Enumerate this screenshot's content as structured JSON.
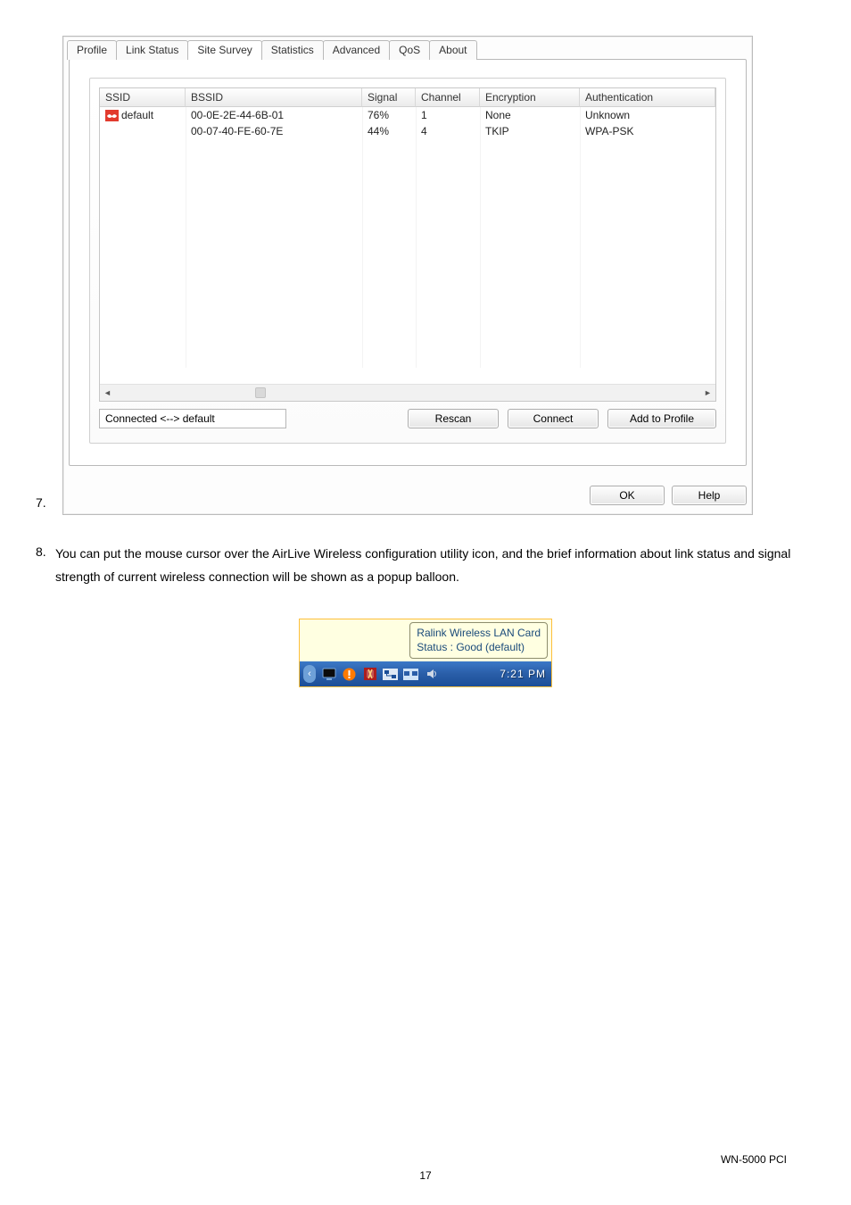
{
  "list_numbers": {
    "seven": "7.",
    "eight": "8."
  },
  "dialog": {
    "tabs": {
      "profile": "Profile",
      "link_status": "Link Status",
      "site_survey": "Site Survey",
      "statistics": "Statistics",
      "advanced": "Advanced",
      "qos": "QoS",
      "about": "About"
    },
    "columns": {
      "ssid": "SSID",
      "bssid": "BSSID",
      "signal": "Signal",
      "channel": "Channel",
      "encryption": "Encryption",
      "authentication": "Authentication"
    },
    "rows": [
      {
        "ssid": "default",
        "bssid": "00-0E-2E-44-6B-01",
        "signal": "76%",
        "channel": "1",
        "encryption": "None",
        "authentication": "Unknown",
        "connected": true
      },
      {
        "ssid": " ",
        "bssid": "00-07-40-FE-60-7E",
        "signal": "44%",
        "channel": "4",
        "encryption": "TKIP",
        "authentication": "WPA-PSK",
        "connected": false
      }
    ],
    "scrollbar": {
      "left": "◄",
      "right": "►",
      "thumb_hint": "III"
    },
    "status_field": "Connected <--> default",
    "buttons": {
      "rescan": "Rescan",
      "connect": "Connect",
      "add_to_profile": "Add to Profile",
      "ok": "OK",
      "help": "Help"
    }
  },
  "body_text": "You can put the mouse cursor over the AirLive Wireless configuration utility icon, and the brief information about link status and signal strength of current wireless connection will be shown as a popup balloon.",
  "balloon": {
    "line1": "Ralink Wireless LAN Card",
    "line2": "Status : Good (default)"
  },
  "taskbar": {
    "icons": [
      "monitor-icon",
      "alert-icon",
      "antivirus-icon",
      "lan-icon",
      "network-icon",
      "volume-icon"
    ],
    "time": "7:21 PM"
  },
  "footer": {
    "page_number": "17",
    "product": "WN-5000 PCI"
  },
  "colors": {
    "tab_border": "#b9b9b9",
    "line": "#f3f3f3",
    "balloon_bg": "#ffffe1",
    "balloon_text": "#1a4a7a",
    "taskbar_gradient_a": "#3b78c7",
    "taskbar_gradient_b": "#1b4e97",
    "tray_border": "#fdbf3b"
  }
}
